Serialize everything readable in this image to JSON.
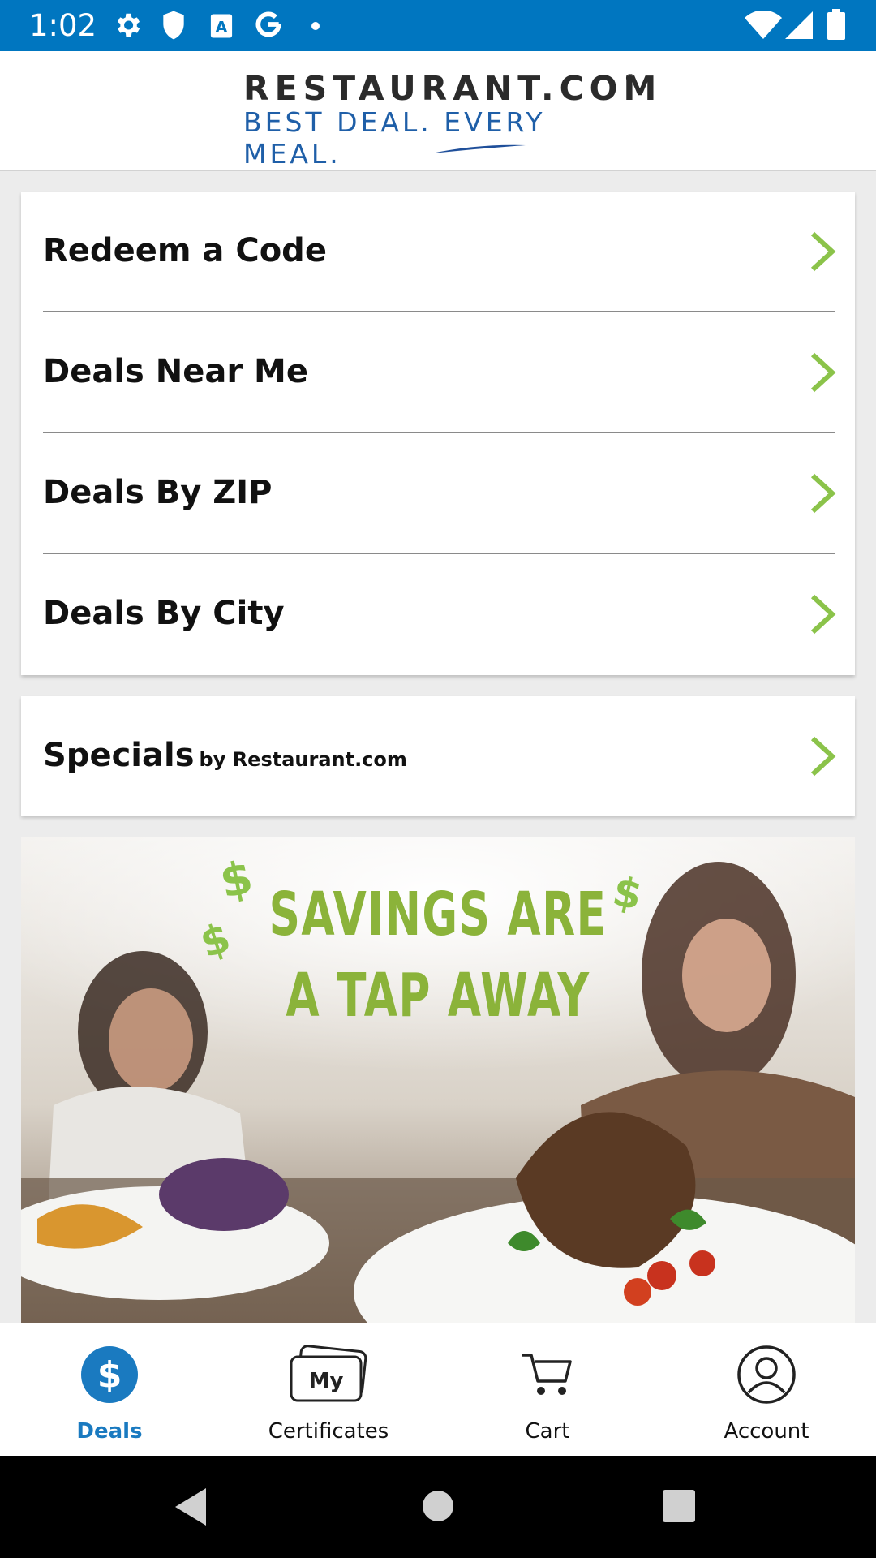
{
  "status_bar": {
    "time": "1:02",
    "icons_left": [
      "settings-gear-icon",
      "shield-icon",
      "font-a-icon",
      "google-g-icon",
      "dot-icon"
    ],
    "icons_right": [
      "wifi-icon",
      "signal-icon",
      "battery-icon"
    ],
    "background": "#0076c0"
  },
  "header": {
    "logo_top": "RESTAURANT.COM",
    "logo_trademark": "®",
    "logo_bottom": "BEST DEAL. EVERY MEAL."
  },
  "menu": {
    "items": [
      {
        "label": "Redeem a Code"
      },
      {
        "label": "Deals Near Me"
      },
      {
        "label": "Deals By ZIP"
      },
      {
        "label": "Deals By City"
      }
    ],
    "chevron_color": "#8bc34a"
  },
  "specials": {
    "label": "Specials",
    "sublabel": "by Restaurant.com"
  },
  "banner": {
    "headline_line1": "SAVINGS ARE",
    "headline_line2": "A TAP AWAY",
    "dollar_sign": "$",
    "headline_color": "#8bb33a"
  },
  "bottom_nav": {
    "items": [
      {
        "label": "Deals",
        "icon": "dollar-circle-icon",
        "active": true
      },
      {
        "label": "Certificates",
        "icon": "my-certificates-icon",
        "active": false
      },
      {
        "label": "Cart",
        "icon": "cart-icon",
        "active": false
      },
      {
        "label": "Account",
        "icon": "account-icon",
        "active": false
      }
    ],
    "active_color": "#1a7ac0",
    "certificates_badge": "My"
  },
  "system_nav": {
    "buttons": [
      "back-icon",
      "home-icon",
      "recents-icon"
    ]
  }
}
